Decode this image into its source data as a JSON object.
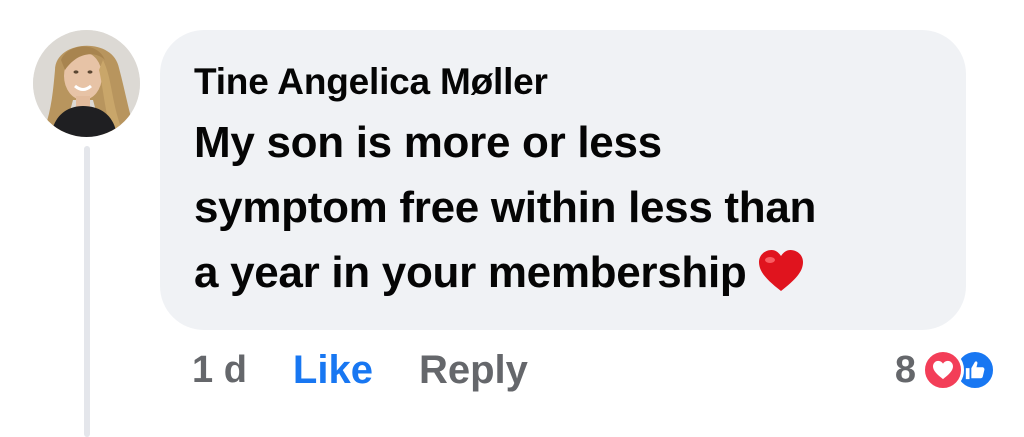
{
  "comment": {
    "author": "Tine Angelica Møller",
    "lines": [
      "My son is more or less",
      "symptom free within less than",
      "a year in your membership"
    ],
    "emoji": "heart-emoji"
  },
  "actions": {
    "timestamp": "1 d",
    "like_label": "Like",
    "reply_label": "Reply"
  },
  "reactions": {
    "count": "8",
    "types": [
      "love",
      "like"
    ]
  },
  "colors": {
    "bubble": "#f0f2f5",
    "like_blue": "#1877f2",
    "love_red": "#f33e58",
    "muted_text": "#65676b"
  }
}
